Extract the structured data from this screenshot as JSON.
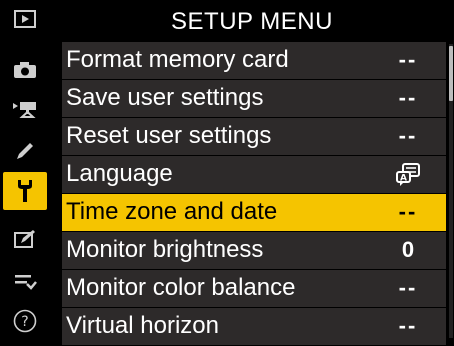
{
  "title": "SETUP MENU",
  "sidebar": {
    "items": [
      {
        "icon": "playback-icon"
      },
      {
        "icon": "camera-icon"
      },
      {
        "icon": "movie-icon"
      },
      {
        "icon": "pencil-icon"
      },
      {
        "icon": "wrench-icon",
        "active": true
      },
      {
        "icon": "retouch-icon"
      },
      {
        "icon": "my-menu-icon"
      },
      {
        "icon": "help-icon"
      }
    ]
  },
  "menu": {
    "items": [
      {
        "label": "Format memory card",
        "value": "--"
      },
      {
        "label": "Save user settings",
        "value": "--"
      },
      {
        "label": "Reset user settings",
        "value": "--"
      },
      {
        "label": "Language",
        "value_icon": "language-icon"
      },
      {
        "label": "Time zone and date",
        "value": "--",
        "selected": true
      },
      {
        "label": "Monitor brightness",
        "value": "0"
      },
      {
        "label": "Monitor color balance",
        "value": "--"
      },
      {
        "label": "Virtual horizon",
        "value": "--"
      }
    ]
  },
  "colors": {
    "accent": "#f5c400",
    "row_bg": "#2d2a2a",
    "background": "#000000"
  }
}
